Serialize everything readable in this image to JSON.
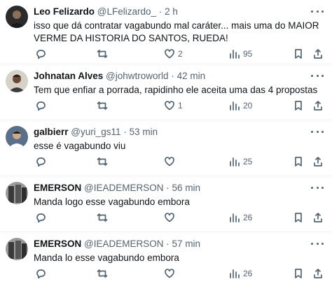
{
  "tweets": [
    {
      "name": "Leo Felizardo",
      "handle": "@LFelizardo_",
      "dot": "·",
      "time": "2 h",
      "text": "isso que dá contratar vagabundo mal caráter... mais uma do MAIOR VERME DA HISTORIA DO SANTOS, RUEDA!",
      "replies": "",
      "retweets": "",
      "likes": "2",
      "views": "95"
    },
    {
      "name": "Johnatan Alves",
      "handle": "@johwtroworld",
      "dot": "·",
      "time": "42 min",
      "text": "Tem que enfiar a porrada, rapidinho ele aceita uma das 4 propostas",
      "replies": "",
      "retweets": "",
      "likes": "1",
      "views": "20"
    },
    {
      "name": "galbierr",
      "handle": "@yuri_gs11",
      "dot": "·",
      "time": "53 min",
      "text": "esse é vagabundo viu",
      "replies": "",
      "retweets": "",
      "likes": "",
      "views": "25"
    },
    {
      "name": "EMERSON",
      "handle": "@IEADEMERSON",
      "dot": "·",
      "time": "56 min",
      "text": "Manda logo esse vagabundo embora",
      "replies": "",
      "retweets": "",
      "likes": "",
      "views": "26"
    },
    {
      "name": "EMERSON",
      "handle": "@IEADEMERSON",
      "dot": "·",
      "time": "57 min",
      "text": "Manda lo esse vagabundo embora",
      "replies": "",
      "retweets": "",
      "likes": "",
      "views": "26"
    }
  ],
  "icons": {
    "reply": "reply-icon",
    "retweet": "retweet-icon",
    "like": "heart-icon",
    "views": "views-icon",
    "bookmark": "bookmark-icon",
    "share": "share-icon",
    "more": "more-options-icon"
  },
  "colors": {
    "text": "#0f1419",
    "secondary": "#536471",
    "divider": "#eff3f4"
  }
}
